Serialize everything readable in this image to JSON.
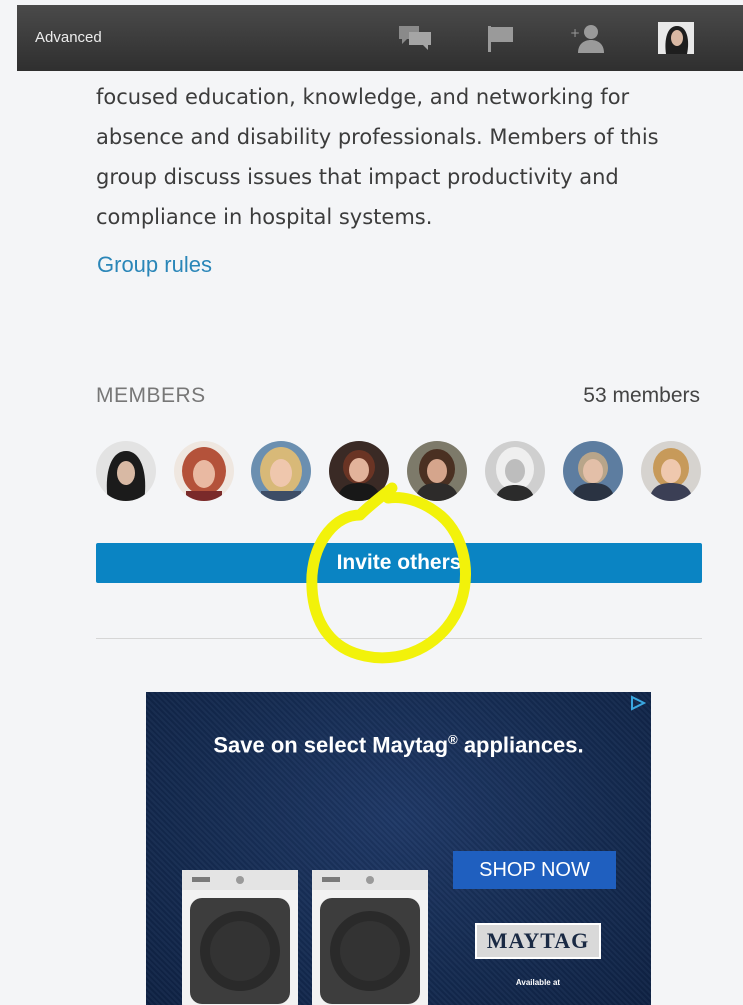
{
  "topbar": {
    "label": "Advanced",
    "icons": [
      "messages-icon",
      "flag-icon",
      "add-connection-icon",
      "profile-avatar"
    ]
  },
  "group": {
    "description": "focused education, knowledge, and networking for absence and disability professionals. Members of this group discuss issues that impact productivity and compliance in hospital systems.",
    "rules_link": "Group rules"
  },
  "members": {
    "heading": "MEMBERS",
    "count": "53 members",
    "avatar_count": 8,
    "invite_label": "Invite others"
  },
  "ad": {
    "headline_prefix": "Save on select Maytag",
    "headline_reg": "®",
    "headline_suffix": " appliances.",
    "cta": "SHOP NOW",
    "brand": "MAYTAG",
    "availability": "Available at"
  },
  "colors": {
    "topbar": "#3a3a3a",
    "link": "#2a86b8",
    "invite_button": "#0a84c3",
    "ad_background": "#142a50",
    "ad_cta": "#1f5fbf",
    "annotation": "#f2f20a"
  }
}
